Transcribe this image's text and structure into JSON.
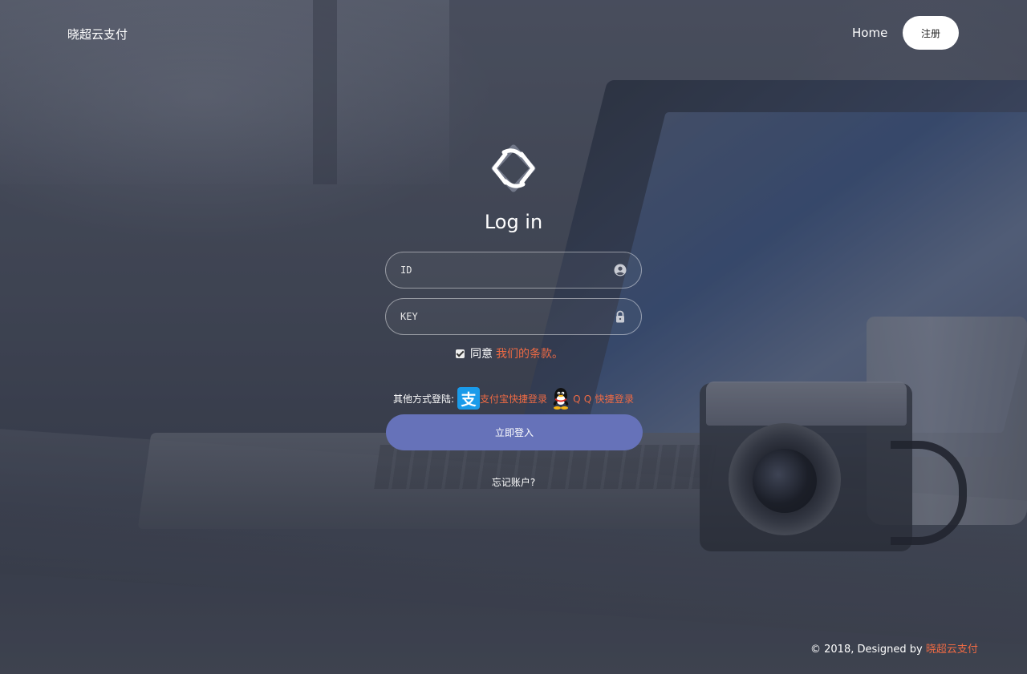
{
  "header": {
    "brand": "晓超云支付",
    "nav_home": "Home",
    "nav_register": "注册"
  },
  "login": {
    "title": "Log in",
    "id_placeholder": "ID",
    "key_placeholder": "KEY",
    "agree_checked": true,
    "agree_text": "同意",
    "terms_link": "我们的条款。",
    "other_methods_label": "其他方式登陆:",
    "alipay_link": "支付宝快捷登录",
    "qq_link": "Q Q 快捷登录",
    "submit": "立即登入",
    "forgot": "忘记账户?"
  },
  "footer": {
    "prefix": "© 2018, Designed by",
    "link": "晓超云支付"
  },
  "colors": {
    "accent_link": "#ee6a44",
    "submit_bg": "#6672b9",
    "alipay_blue": "#1a9bea"
  },
  "icons": {
    "logo": "diamond-logo-icon",
    "id_field": "user-circle-icon",
    "key_field": "lock-icon",
    "checkbox": "checkbox-checked-icon",
    "alipay": "alipay-icon",
    "qq": "qq-penguin-icon"
  }
}
